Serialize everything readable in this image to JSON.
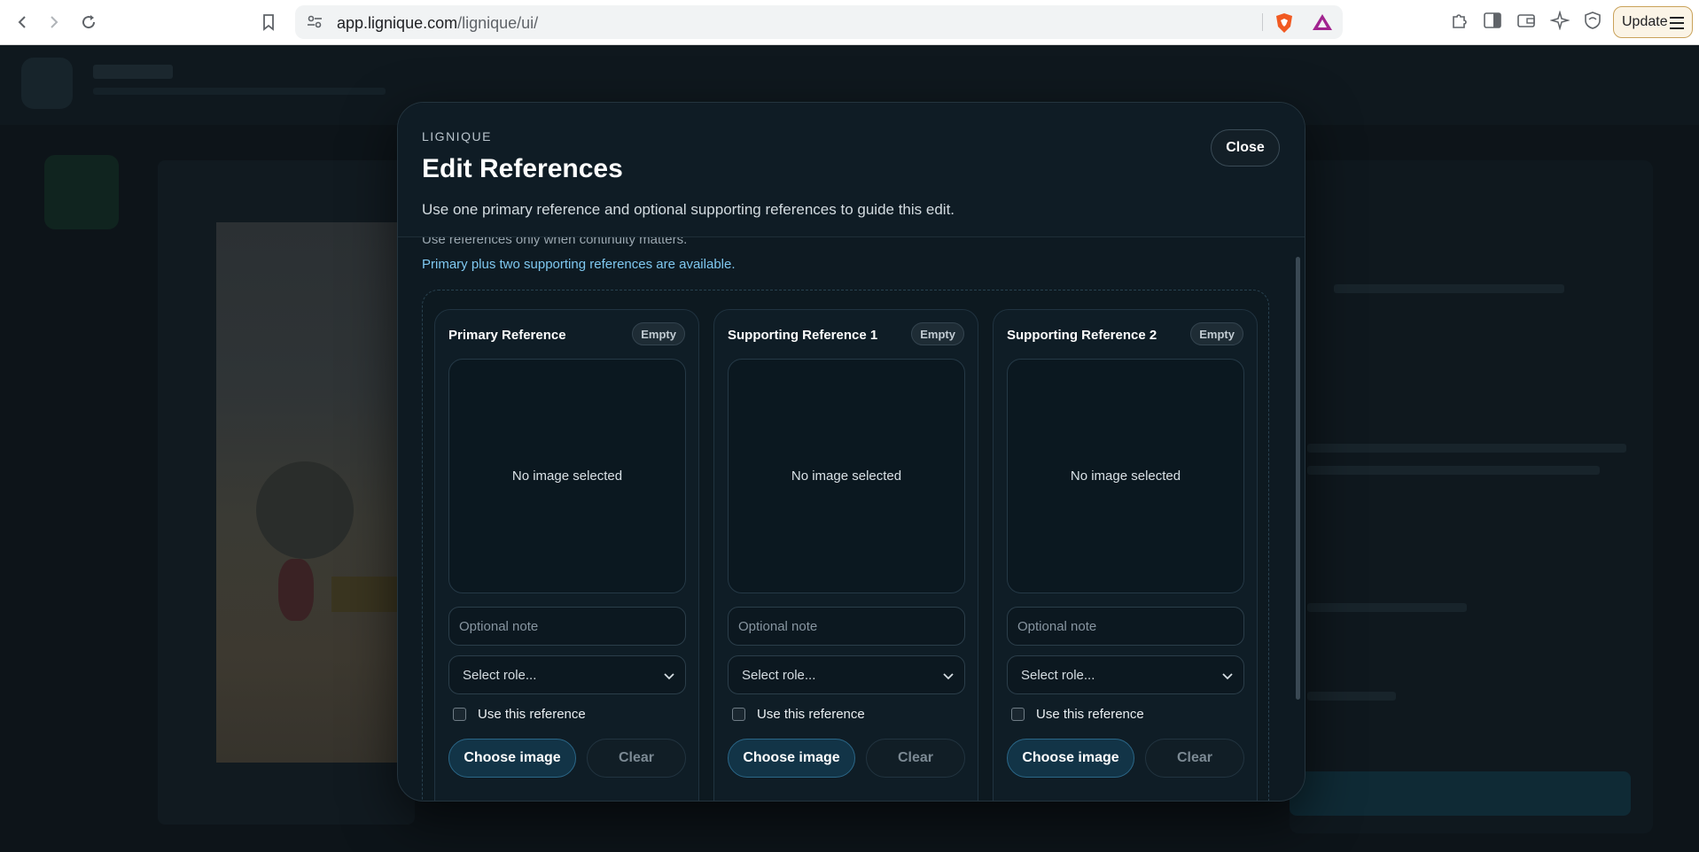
{
  "browser": {
    "url_host": "app.lignique.com",
    "url_path": "/lignique/ui/",
    "update_label": "Update"
  },
  "modal": {
    "eyebrow": "LIGNIQUE",
    "title": "Edit References",
    "subtitle": "Use one primary reference and optional supporting references to guide this edit.",
    "close_label": "Close",
    "hint_text": "Use references only when continuity matters.",
    "info_text": "Primary plus two supporting references are available."
  },
  "cards": [
    {
      "title": "Primary Reference",
      "badge": "Empty",
      "preview_text": "No image selected",
      "note_placeholder": "Optional note",
      "role_selected": "Select role...",
      "use_label": "Use this reference",
      "use_checked": false,
      "choose_label": "Choose image",
      "clear_label": "Clear"
    },
    {
      "title": "Supporting Reference 1",
      "badge": "Empty",
      "preview_text": "No image selected",
      "note_placeholder": "Optional note",
      "role_selected": "Select role...",
      "use_label": "Use this reference",
      "use_checked": false,
      "choose_label": "Choose image",
      "clear_label": "Clear"
    },
    {
      "title": "Supporting Reference 2",
      "badge": "Empty",
      "preview_text": "No image selected",
      "note_placeholder": "Optional note",
      "role_selected": "Select role...",
      "use_label": "Use this reference",
      "use_checked": false,
      "choose_label": "Choose image",
      "clear_label": "Clear"
    }
  ],
  "colors": {
    "accent": "#7fc8f0",
    "modal_bg": "#0e1a22",
    "primary_button": "#123447"
  }
}
